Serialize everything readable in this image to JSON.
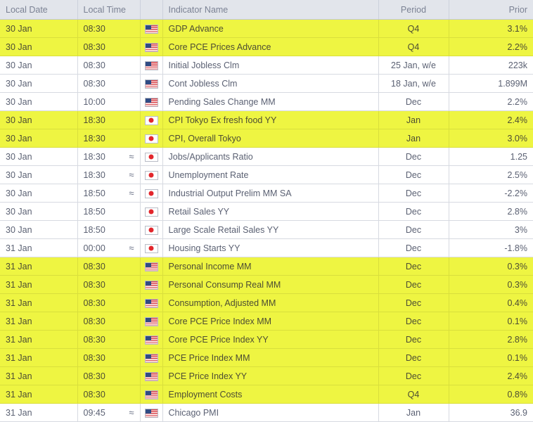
{
  "table": {
    "columns": [
      {
        "key": "date",
        "label": "Local Date",
        "align": "left"
      },
      {
        "key": "time",
        "label": "Local Time",
        "align": "left"
      },
      {
        "key": "flag",
        "label": "",
        "align": "center"
      },
      {
        "key": "name",
        "label": "Indicator Name",
        "align": "left"
      },
      {
        "key": "period",
        "label": "Period",
        "align": "center"
      },
      {
        "key": "prior",
        "label": "Prior",
        "align": "right"
      }
    ],
    "colors": {
      "header_bg": "#e2e5eb",
      "header_text": "#7b8294",
      "row_bg": "#ffffff",
      "row_text": "#5b6173",
      "highlight_bg": "#eef542",
      "highlight_text": "#4d4d33",
      "grid_line": "#d7dae1"
    },
    "icons": {
      "approx": "≈",
      "flag_us": "flag-united-states",
      "flag_jp": "flag-japan"
    },
    "rows": [
      {
        "date": "30 Jan",
        "time": "08:30",
        "approx": false,
        "flag": "us",
        "name": "GDP Advance",
        "period": "Q4",
        "prior": "3.1%",
        "highlight": true
      },
      {
        "date": "30 Jan",
        "time": "08:30",
        "approx": false,
        "flag": "us",
        "name": "Core PCE Prices Advance",
        "period": "Q4",
        "prior": "2.2%",
        "highlight": true
      },
      {
        "date": "30 Jan",
        "time": "08:30",
        "approx": false,
        "flag": "us",
        "name": "Initial Jobless Clm",
        "period": "25 Jan, w/e",
        "prior": "223k",
        "highlight": false
      },
      {
        "date": "30 Jan",
        "time": "08:30",
        "approx": false,
        "flag": "us",
        "name": "Cont Jobless Clm",
        "period": "18 Jan, w/e",
        "prior": "1.899M",
        "highlight": false
      },
      {
        "date": "30 Jan",
        "time": "10:00",
        "approx": false,
        "flag": "us",
        "name": "Pending Sales Change MM",
        "period": "Dec",
        "prior": "2.2%",
        "highlight": false
      },
      {
        "date": "30 Jan",
        "time": "18:30",
        "approx": false,
        "flag": "jp",
        "name": "CPI Tokyo Ex fresh food YY",
        "period": "Jan",
        "prior": "2.4%",
        "highlight": true
      },
      {
        "date": "30 Jan",
        "time": "18:30",
        "approx": false,
        "flag": "jp",
        "name": "CPI, Overall Tokyo",
        "period": "Jan",
        "prior": "3.0%",
        "highlight": true
      },
      {
        "date": "30 Jan",
        "time": "18:30",
        "approx": true,
        "flag": "jp",
        "name": "Jobs/Applicants Ratio",
        "period": "Dec",
        "prior": "1.25",
        "highlight": false
      },
      {
        "date": "30 Jan",
        "time": "18:30",
        "approx": true,
        "flag": "jp",
        "name": "Unemployment Rate",
        "period": "Dec",
        "prior": "2.5%",
        "highlight": false
      },
      {
        "date": "30 Jan",
        "time": "18:50",
        "approx": true,
        "flag": "jp",
        "name": "Industrial Output Prelim MM SA",
        "period": "Dec",
        "prior": "-2.2%",
        "highlight": false
      },
      {
        "date": "30 Jan",
        "time": "18:50",
        "approx": false,
        "flag": "jp",
        "name": "Retail Sales YY",
        "period": "Dec",
        "prior": "2.8%",
        "highlight": false
      },
      {
        "date": "30 Jan",
        "time": "18:50",
        "approx": false,
        "flag": "jp",
        "name": "Large Scale Retail Sales YY",
        "period": "Dec",
        "prior": "3%",
        "highlight": false
      },
      {
        "date": "31 Jan",
        "time": "00:00",
        "approx": true,
        "flag": "jp",
        "name": "Housing Starts YY",
        "period": "Dec",
        "prior": "-1.8%",
        "highlight": false
      },
      {
        "date": "31 Jan",
        "time": "08:30",
        "approx": false,
        "flag": "us",
        "name": "Personal Income MM",
        "period": "Dec",
        "prior": "0.3%",
        "highlight": true
      },
      {
        "date": "31 Jan",
        "time": "08:30",
        "approx": false,
        "flag": "us",
        "name": "Personal Consump Real MM",
        "period": "Dec",
        "prior": "0.3%",
        "highlight": true
      },
      {
        "date": "31 Jan",
        "time": "08:30",
        "approx": false,
        "flag": "us",
        "name": "Consumption, Adjusted MM",
        "period": "Dec",
        "prior": "0.4%",
        "highlight": true
      },
      {
        "date": "31 Jan",
        "time": "08:30",
        "approx": false,
        "flag": "us",
        "name": "Core PCE Price Index MM",
        "period": "Dec",
        "prior": "0.1%",
        "highlight": true
      },
      {
        "date": "31 Jan",
        "time": "08:30",
        "approx": false,
        "flag": "us",
        "name": "Core PCE Price Index YY",
        "period": "Dec",
        "prior": "2.8%",
        "highlight": true
      },
      {
        "date": "31 Jan",
        "time": "08:30",
        "approx": false,
        "flag": "us",
        "name": "PCE Price Index MM",
        "period": "Dec",
        "prior": "0.1%",
        "highlight": true
      },
      {
        "date": "31 Jan",
        "time": "08:30",
        "approx": false,
        "flag": "us",
        "name": "PCE Price Index YY",
        "period": "Dec",
        "prior": "2.4%",
        "highlight": true
      },
      {
        "date": "31 Jan",
        "time": "08:30",
        "approx": false,
        "flag": "us",
        "name": "Employment Costs",
        "period": "Q4",
        "prior": "0.8%",
        "highlight": true
      },
      {
        "date": "31 Jan",
        "time": "09:45",
        "approx": true,
        "flag": "us",
        "name": "Chicago PMI",
        "period": "Jan",
        "prior": "36.9",
        "highlight": false
      }
    ]
  }
}
